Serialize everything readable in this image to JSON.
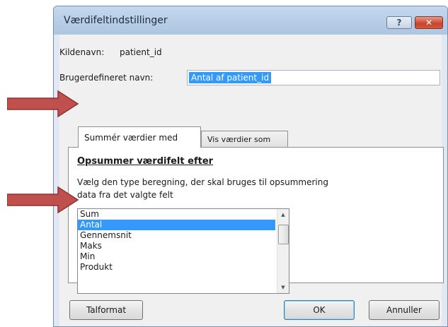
{
  "dialog": {
    "title": "Værdifeltindstillinger",
    "help_label": "?",
    "close_label": "✕",
    "source_label": "Kildenavn:",
    "source_value": "patient_id",
    "custom_name_label": "Brugerdefineret navn:",
    "custom_name_value": "Antal af patient_id"
  },
  "tabs": [
    {
      "label": "Summér værdier med",
      "active": true
    },
    {
      "label": "Vis værdier som",
      "active": false
    }
  ],
  "panel": {
    "group_title": "Opsummer værdifelt efter",
    "description_line1": "Vælg den type beregning, der skal bruges til opsummering",
    "description_line2": "data fra det valgte felt",
    "options": [
      "Sum",
      "Antal",
      "Gennemsnit",
      "Maks",
      "Min",
      "Produkt"
    ],
    "selected_option": "Antal"
  },
  "buttons": {
    "number_format": "Talformat",
    "ok": "OK",
    "cancel": "Annuller"
  },
  "colors": {
    "annotation_arrow": "#c0504d",
    "selection": "#3399ff"
  }
}
